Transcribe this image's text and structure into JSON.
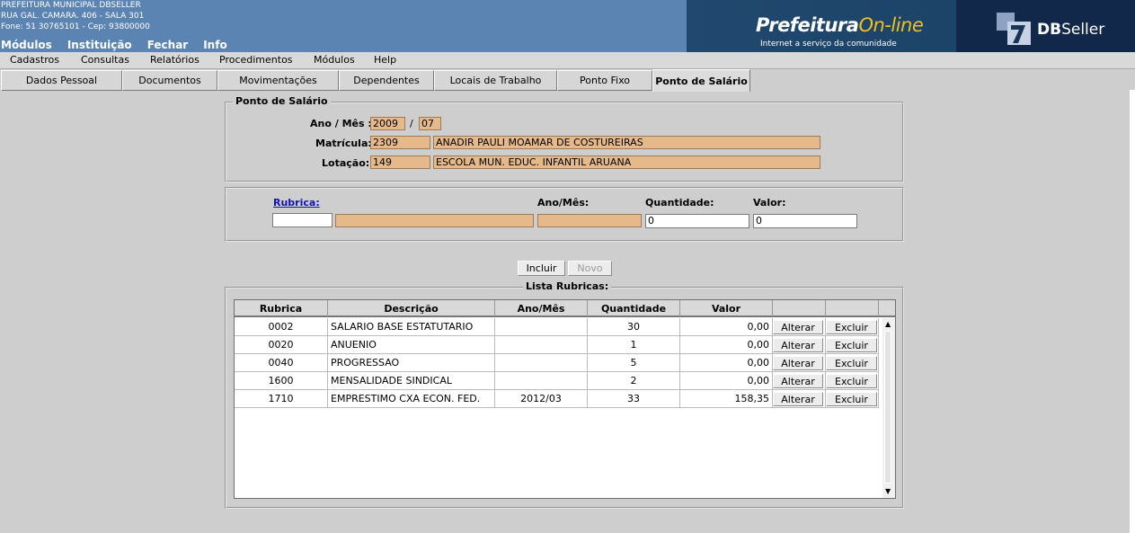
{
  "header": {
    "org_name": "PREFEITURA MUNICIPAL DBSELLER",
    "address": "RUA GAL. CAMARA. 406 - SALA 301",
    "phone": "Fone: 51 30765101  - Cep: 93800000",
    "links": [
      "Módulos",
      "Instituição",
      "Fechar",
      "Info"
    ],
    "banner_brand": "Prefeitura",
    "banner_brand_accent": "On-line",
    "banner_tagline": "Internet a serviço da comunidade",
    "company_bold": "DB",
    "company_rest": "Seller"
  },
  "menu": [
    "Cadastros",
    "Consultas",
    "Relatórios",
    "Procedimentos",
    "Módulos",
    "Help"
  ],
  "tabs": [
    {
      "label": "Dados Pessoal"
    },
    {
      "label": "Documentos"
    },
    {
      "label": "Movimentações"
    },
    {
      "label": "Dependentes"
    },
    {
      "label": "Locais de Trabalho"
    },
    {
      "label": "Ponto Fixo"
    },
    {
      "label": "Ponto de Salário",
      "active": true
    }
  ],
  "ponto": {
    "legend": "Ponto de Salário",
    "ano_mes_label": "Ano / Mês :",
    "ano": "2009",
    "separator": "/",
    "mes": "07",
    "matricula_label": "Matrícula:",
    "matricula": "2309",
    "nome": "ANADIR PAULI MOAMAR DE COSTUREIRAS",
    "lotacao_label": "Lotação:",
    "lotacao_code": "149",
    "lotacao_desc": "ESCOLA MUN. EDUC. INFANTIL ARUANA"
  },
  "rubrica_form": {
    "rubrica_label": "Rubrica:",
    "anomes_label": "Ano/Mês:",
    "quantidade_label": "Quantidade:",
    "valor_label": "Valor:",
    "rubrica_value": "",
    "descricao_value": "",
    "anomes_value": "",
    "quantidade_value": "0",
    "valor_value": "0"
  },
  "buttons": {
    "incluir": "Incluir",
    "novo": "Novo"
  },
  "lista": {
    "legend": "Lista Rubricas:",
    "columns": [
      "Rubrica",
      "Descrição",
      "Ano/Mês",
      "Quantidade",
      "Valor",
      "",
      ""
    ],
    "alterar_label": "Alterar",
    "excluir_label": "Excluir",
    "rows": [
      {
        "rubrica": "0002",
        "descricao": "SALARIO BASE ESTATUTARIO",
        "anomes": "",
        "quantidade": "30",
        "valor": "0,00"
      },
      {
        "rubrica": "0020",
        "descricao": "ANUENIO",
        "anomes": "",
        "quantidade": "1",
        "valor": "0,00"
      },
      {
        "rubrica": "0040",
        "descricao": "PROGRESSAO",
        "anomes": "",
        "quantidade": "5",
        "valor": "0,00"
      },
      {
        "rubrica": "1600",
        "descricao": "MENSALIDADE SINDICAL",
        "anomes": "",
        "quantidade": "2",
        "valor": "0,00"
      },
      {
        "rubrica": "1710",
        "descricao": "EMPRESTIMO CXA ECON. FED.",
        "anomes": "2012/03",
        "quantidade": "33",
        "valor": "158,35"
      }
    ]
  },
  "colors": {
    "header_bg": "#5b84b3",
    "field_bg": "#e6b98a",
    "page_bg": "#cecece"
  }
}
